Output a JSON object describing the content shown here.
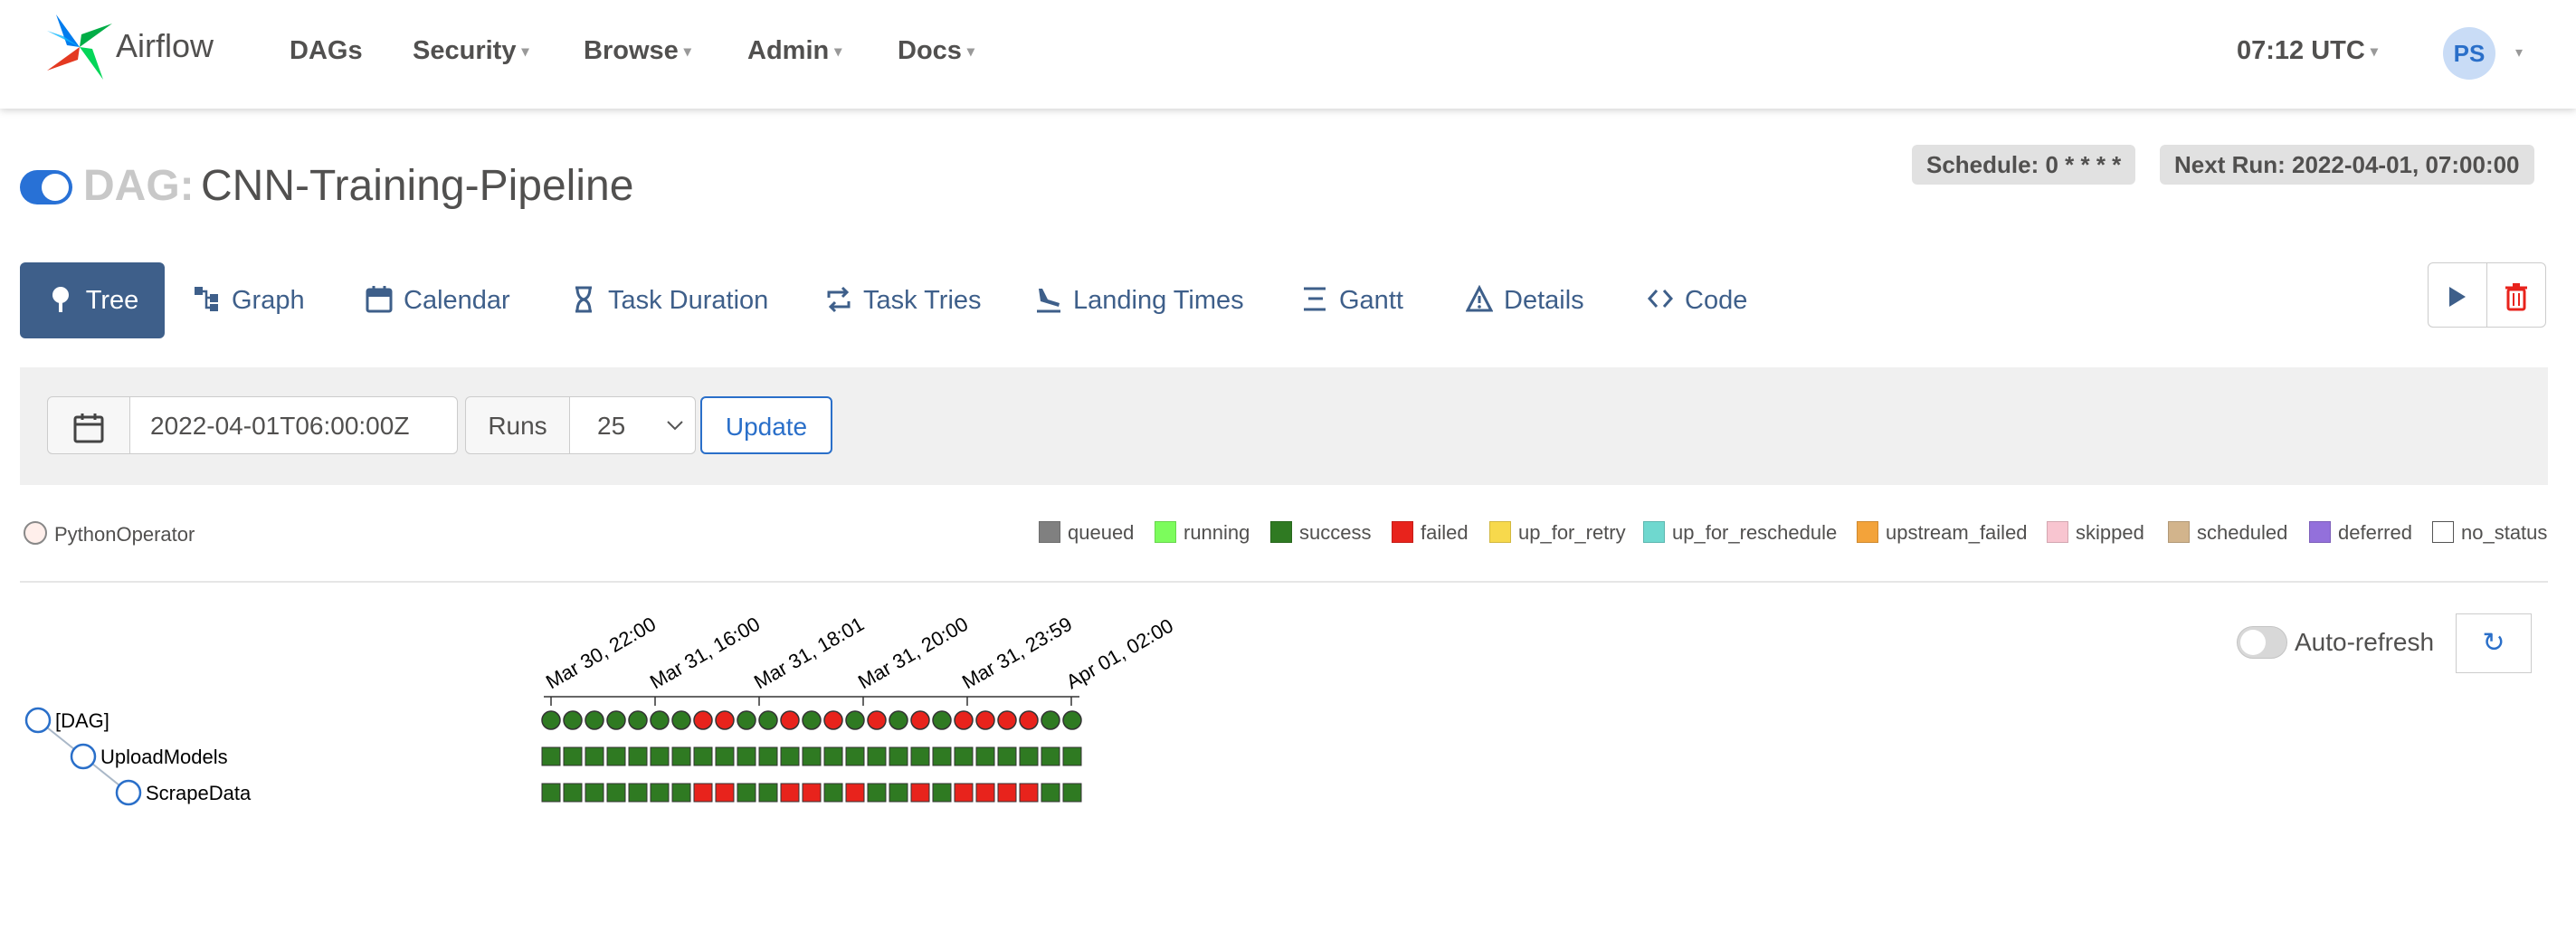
{
  "app": {
    "name": "Airflow",
    "time": "07:12 UTC",
    "user_initials": "PS"
  },
  "nav": [
    {
      "label": "DAGs",
      "dropdown": false
    },
    {
      "label": "Security",
      "dropdown": true
    },
    {
      "label": "Browse",
      "dropdown": true
    },
    {
      "label": "Admin",
      "dropdown": true
    },
    {
      "label": "Docs",
      "dropdown": true
    }
  ],
  "dag": {
    "prefix": "DAG:",
    "name": "CNN-Training-Pipeline",
    "enabled": true,
    "schedule": "Schedule: 0 * * * *",
    "next_run": "Next Run: 2022-04-01, 07:00:00"
  },
  "tabs": [
    {
      "label": "Tree",
      "icon": "tree-icon",
      "active": true
    },
    {
      "label": "Graph",
      "icon": "graph-icon",
      "active": false
    },
    {
      "label": "Calendar",
      "icon": "calendar-icon",
      "active": false
    },
    {
      "label": "Task Duration",
      "icon": "hourglass-icon",
      "active": false
    },
    {
      "label": "Task Tries",
      "icon": "retry-icon",
      "active": false
    },
    {
      "label": "Landing Times",
      "icon": "plane-landing-icon",
      "active": false
    },
    {
      "label": "Gantt",
      "icon": "gantt-icon",
      "active": false
    },
    {
      "label": "Details",
      "icon": "warning-triangle-icon",
      "active": false
    },
    {
      "label": "Code",
      "icon": "code-icon",
      "active": false
    }
  ],
  "filters": {
    "base_date": "2022-04-01T06:00:00Z",
    "runs_label": "Runs",
    "runs_value": "25",
    "update_label": "Update"
  },
  "operator_legend": {
    "label": "PythonOperator",
    "color": "#ffefeb"
  },
  "state_legend": [
    {
      "label": "queued",
      "color": "#808080"
    },
    {
      "label": "running",
      "color": "#7cfc5c"
    },
    {
      "label": "success",
      "color": "#2f7a22"
    },
    {
      "label": "failed",
      "color": "#e8231c"
    },
    {
      "label": "up_for_retry",
      "color": "#f7d94c"
    },
    {
      "label": "up_for_reschedule",
      "color": "#6fd8cf"
    },
    {
      "label": "upstream_failed",
      "color": "#f3a33a"
    },
    {
      "label": "skipped",
      "color": "#f8c5d0"
    },
    {
      "label": "scheduled",
      "color": "#d2b48c"
    },
    {
      "label": "deferred",
      "color": "#9370db"
    },
    {
      "label": "no_status",
      "color": "#ffffff"
    }
  ],
  "auto_refresh": {
    "label": "Auto-refresh",
    "enabled": false
  },
  "tree": {
    "dates": [
      "Mar 30, 22:00",
      "Mar 31, 16:00",
      "Mar 31, 18:01",
      "Mar 31, 20:00",
      "Mar 31, 23:59",
      "Apr 01, 02:00"
    ],
    "nodes": [
      "[DAG]",
      "UploadModels",
      "ScrapeData"
    ],
    "runs": [
      "success",
      "success",
      "success",
      "success",
      "success",
      "success",
      "success",
      "failed",
      "failed",
      "success",
      "success",
      "failed",
      "success",
      "failed",
      "success",
      "failed",
      "success",
      "failed",
      "success",
      "failed",
      "failed",
      "failed",
      "failed",
      "success",
      "success"
    ],
    "upload": [
      "success",
      "success",
      "success",
      "success",
      "success",
      "success",
      "success",
      "success",
      "success",
      "success",
      "success",
      "success",
      "success",
      "success",
      "success",
      "success",
      "success",
      "success",
      "success",
      "success",
      "success",
      "success",
      "success",
      "success",
      "success"
    ],
    "scrape": [
      "success",
      "success",
      "success",
      "success",
      "success",
      "success",
      "success",
      "failed",
      "failed",
      "success",
      "success",
      "failed",
      "failed",
      "success",
      "failed",
      "success",
      "success",
      "failed",
      "success",
      "failed",
      "failed",
      "failed",
      "failed",
      "success",
      "success"
    ]
  },
  "colors": {
    "accent": "#3e5f8a",
    "success": "#2f7a22",
    "failed": "#e8231c",
    "link": "#2a6fc9"
  }
}
